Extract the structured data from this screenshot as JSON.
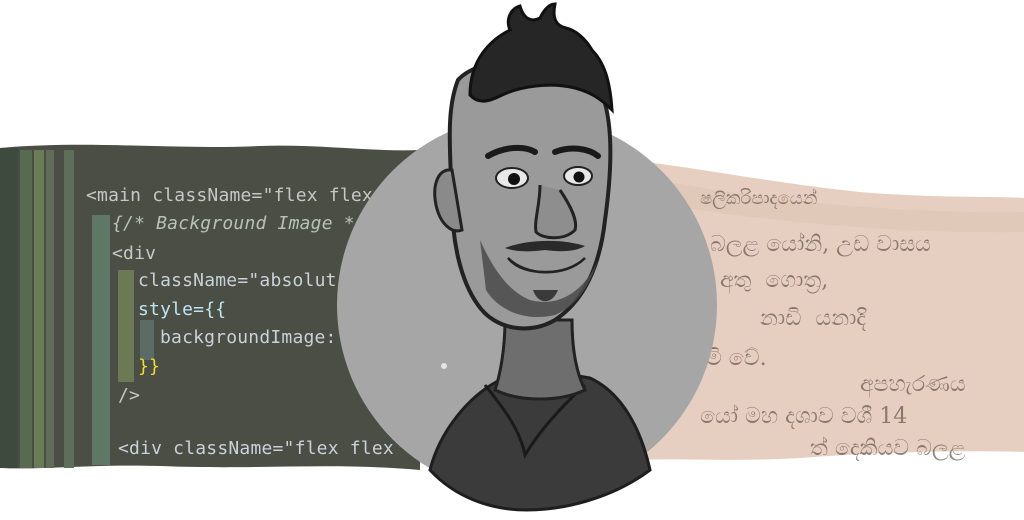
{
  "code": {
    "lines": [
      "<main className=\"flex flex",
      "{/* Background Image *",
      "<div",
      "className=\"absolut",
      "style={{",
      "backgroundImage:",
      "}}",
      "/>",
      "<div className=\"flex flex"
    ]
  },
  "manuscript": {
    "lines": [
      "ෂලිකරිපාදයෙන්",
      "බලළ යෝනි, උඩ වාසය",
      "අතු  ගොත්‍ර,",
      "නාඩි  යනාදි",
      "මි වේ.",
      "අපහැරණය",
      "යෝ මහ දශාව වශී 14",
      "ත් දෙකියව බලළ"
    ]
  },
  "colors": {
    "code_bg": "#4a4e45",
    "paper_bg": "#e6cfc0",
    "circle": "#a6a6a6"
  }
}
